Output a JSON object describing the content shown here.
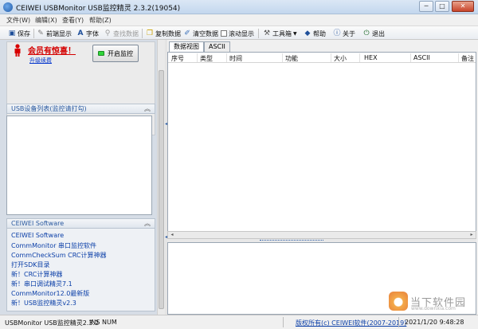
{
  "window": {
    "title": "CEIWEI USBMonitor USB监控精灵 2.3.2(19054)",
    "controls": {
      "minimize": "─",
      "maximize": "□",
      "close": "✕"
    }
  },
  "menu": [
    "文件(W)",
    "编辑(X)",
    "查看(Y)",
    "帮助(Z)"
  ],
  "toolbar": {
    "save": "保存",
    "scroll_to_top": "前端显示",
    "font": "字体",
    "find": "查找数据",
    "copy": "复制数据",
    "clear": "清空数据",
    "auto_scroll": "滚动显示",
    "tools": "工具箱",
    "help": "帮助",
    "about": "关于",
    "exit": "退出"
  },
  "promo": {
    "title": "会员有惊喜！",
    "link": "升级续费",
    "start_button": "开启监控"
  },
  "sections": {
    "device_list": "USB设备列表(监控请打勾)",
    "software": "CEIWEI Software"
  },
  "software_links": [
    "CEIWEI Software",
    "CommMonitor 串口监控软件",
    "CommCheckSum CRC计算神器",
    "打开SDK目录",
    "新！CRC计算神器",
    "新！串口调试精灵7.1",
    "CommMonitor12.0最新版",
    "新！USB监控精灵v2.3"
  ],
  "tabs": [
    "数据视图",
    "ASCII"
  ],
  "columns": [
    "序号",
    "类型",
    "时间",
    "功能",
    "大小",
    "HEX",
    "ASCII",
    "备注"
  ],
  "status": {
    "app": "USBMonitor USB监控精灵2.3.2",
    "ins": "INS",
    "num": "NUM",
    "copyright": "版权所有(c) CEIWEI软件(2007-2019)",
    "datetime": "2021/1/20 9:48:28"
  },
  "watermark": {
    "text": "当下软件园",
    "sub": "www.downxia.com"
  },
  "icons": [
    "app-icon",
    "save-icon",
    "pin-icon",
    "font-icon",
    "search-icon",
    "copy-icon",
    "clear-icon",
    "checkbox-icon",
    "tools-icon",
    "help-icon",
    "info-icon",
    "exit-icon",
    "person-icon",
    "collapse-icon"
  ]
}
